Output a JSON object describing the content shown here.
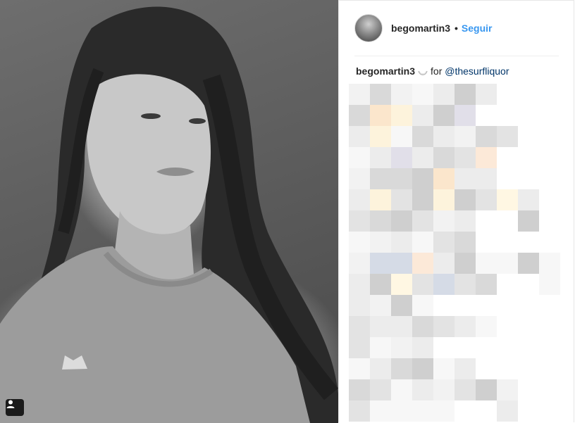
{
  "post": {
    "username": "begomartin3",
    "follow_label": "Seguir",
    "separator": "•",
    "caption": {
      "username": "begomartin3",
      "connector": "for",
      "mention": "@thesurfliquor"
    }
  },
  "icons": {
    "tag": "person-tag-icon",
    "caption_emoji": "moon-emoji-icon"
  },
  "colors": {
    "follow": "#3897f0",
    "mention": "#003569",
    "text": "#262626",
    "divider": "#efefef"
  }
}
